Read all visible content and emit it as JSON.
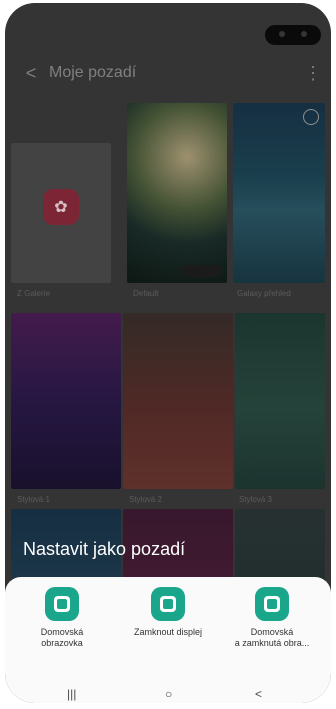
{
  "status": {
    "camera_icon": "camera-cutout"
  },
  "appbar": {
    "back_icon": "chevron-left-icon",
    "title": "Moje pozadí",
    "more_icon": "more-vert-icon"
  },
  "wallpapers": {
    "items": [
      {
        "label": "Z Galerie"
      },
      {
        "label": "Default"
      },
      {
        "label": "Galaxy přehled"
      },
      {
        "label": "Stylová 1"
      },
      {
        "label": "Stylová 2"
      },
      {
        "label": "Stylová 3"
      }
    ]
  },
  "sheet": {
    "title": "Nastavit jako pozadí",
    "options": [
      {
        "label_line1": "Domovská",
        "label_line2": "obrazovka",
        "icon": "home-screen-icon"
      },
      {
        "label_line1": "Zamknout displej",
        "label_line2": "",
        "icon": "lock-screen-icon"
      },
      {
        "label_line1": "Domovská",
        "label_line2": "a zamknutá obra...",
        "icon": "home-and-lock-icon"
      }
    ]
  },
  "navbar": {
    "recent": "|||",
    "home": "○",
    "back": "<"
  },
  "colors": {
    "accent": "#19a68a",
    "gallery": "#8a2a3b"
  }
}
